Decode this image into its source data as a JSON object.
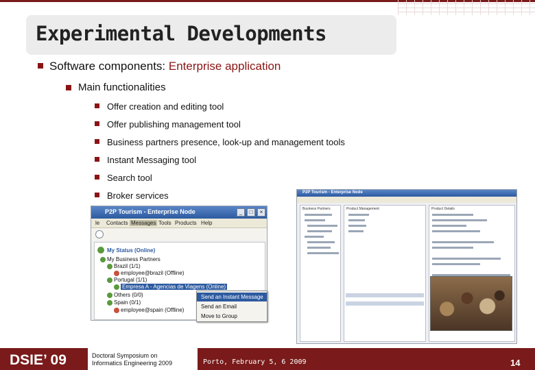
{
  "slide": {
    "title": "Experimental Developments",
    "level1": {
      "prefix": "Software components:",
      "accent": "Enterprise application"
    },
    "level2": "Main functionalities",
    "items": [
      "Offer creation and editing tool",
      "Offer publishing management tool",
      "Business partners presence, look-up and management tools",
      "Instant Messaging  tool",
      "Search tool",
      "Broker services"
    ]
  },
  "messenger": {
    "window_title": "P2P Tourism - Enterprise Node",
    "menus": [
      "le",
      "Contacts",
      "Messages",
      "Tools",
      "Products",
      "Help"
    ],
    "status": "My Status (Online)",
    "tree": [
      "My Business Partners",
      "Brazil (1/1)",
      "employee@brazil (Offline)",
      "Portugal (1/1)",
      "Empresa A - Agencias de Viagens (Online)",
      "Others (0/0)",
      "Spain (0/1)",
      "employee@spain (Offline)"
    ],
    "context_menu": [
      "Send an Instant Message",
      "Send an Email",
      "Move to Group"
    ]
  },
  "enterprise_app": {
    "window_title": "P2P Tourism - Enterprise Node",
    "pane_left": "Business Partners",
    "pane_mid": "Product Management",
    "pane_right": "Product Details"
  },
  "footer": {
    "logo": "DSIE’ 09",
    "symposium_line1": "Doctoral Symposium on",
    "symposium_line2": "Informatics Engineering 2009",
    "date": "Porto, February 5, 6 2009",
    "page": "14"
  },
  "colors": {
    "accent": "#8a1414",
    "footer": "#7a1a1a",
    "window": "#2c5aa0"
  }
}
